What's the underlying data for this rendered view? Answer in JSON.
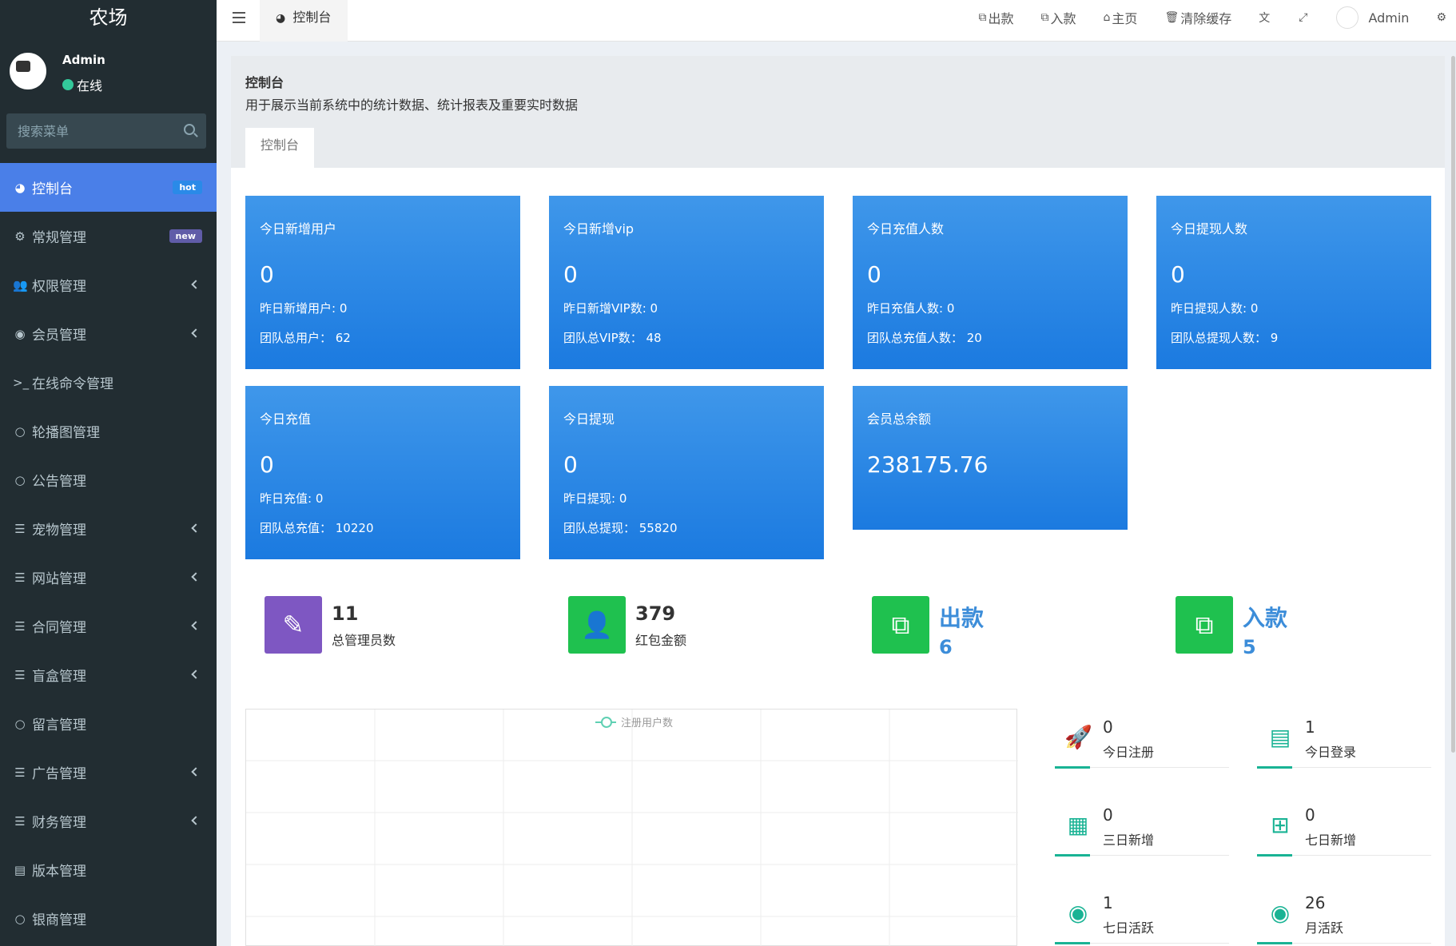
{
  "app": {
    "brand": "农场"
  },
  "user": {
    "name": "Admin",
    "status": "在线"
  },
  "search": {
    "placeholder": "搜索菜单"
  },
  "menu": [
    {
      "label": "控制台",
      "icon": "dashboard-icon",
      "badge": "hot"
    },
    {
      "label": "常规管理",
      "icon": "cogs-icon",
      "badge": "new"
    },
    {
      "label": "权限管理",
      "icon": "users-icon",
      "chevron": true
    },
    {
      "label": "会员管理",
      "icon": "user-circle-icon",
      "chevron": true
    },
    {
      "label": "在线命令管理",
      "icon": "terminal-icon"
    },
    {
      "label": "轮播图管理",
      "icon": "circle-icon"
    },
    {
      "label": "公告管理",
      "icon": "circle-icon"
    },
    {
      "label": "宠物管理",
      "icon": "list-icon",
      "chevron": true
    },
    {
      "label": "网站管理",
      "icon": "list-icon",
      "chevron": true
    },
    {
      "label": "合同管理",
      "icon": "list-icon",
      "chevron": true
    },
    {
      "label": "盲盒管理",
      "icon": "list-icon",
      "chevron": true
    },
    {
      "label": "留言管理",
      "icon": "circle-icon"
    },
    {
      "label": "广告管理",
      "icon": "list-icon",
      "chevron": true
    },
    {
      "label": "财务管理",
      "icon": "list-icon",
      "chevron": true
    },
    {
      "label": "版本管理",
      "icon": "file-icon"
    },
    {
      "label": "银商管理",
      "icon": "circle-icon"
    }
  ],
  "topbar": {
    "tab": "控制台",
    "nav": [
      "出款",
      "入款",
      "主页",
      "清除缓存"
    ],
    "user": "Admin"
  },
  "header": {
    "title": "控制台",
    "desc": "用于展示当前系统中的统计数据、统计报表及重要实时数据",
    "tab": "控制台"
  },
  "cards": [
    {
      "title": "今日新增用户",
      "value": "0",
      "line1": "昨日新增用户: 0",
      "line2": "团队总用户： 62"
    },
    {
      "title": "今日新增vip",
      "value": "0",
      "line1": "昨日新增VIP数: 0",
      "line2": "团队总VIP数： 48"
    },
    {
      "title": "今日充值人数",
      "value": "0",
      "line1": "昨日充值人数: 0",
      "line2": "团队总充值人数： 20"
    },
    {
      "title": "今日提现人数",
      "value": "0",
      "line1": "昨日提现人数: 0",
      "line2": "团队总提现人数： 9"
    },
    {
      "title": "今日充值",
      "value": "0",
      "line1": "昨日充值: 0",
      "line2": "团队总充值： 10220"
    },
    {
      "title": "今日提现",
      "value": "0",
      "line1": "昨日提现: 0",
      "line2": "团队总提现： 55820"
    },
    {
      "title": "会员总余额",
      "value": "238175.76"
    }
  ],
  "mini": [
    {
      "num": "11",
      "label": "总管理员数",
      "color": "#7e57c2"
    },
    {
      "num": "379",
      "label": "红包金额",
      "color": "#1fc14f"
    },
    {
      "big": "出款",
      "bignum": "6",
      "color": "#1fc14f"
    },
    {
      "big": "入款",
      "bignum": "5",
      "color": "#1fc14f"
    }
  ],
  "chart": {
    "legend": "注册用户数"
  },
  "stats": [
    {
      "num": "0",
      "label": "今日注册",
      "icon": "rocket-icon"
    },
    {
      "num": "1",
      "label": "今日登录",
      "icon": "id-card-icon"
    },
    {
      "num": "0",
      "label": "三日新增",
      "icon": "calendar-icon"
    },
    {
      "num": "0",
      "label": "七日新增",
      "icon": "calendar-plus-icon"
    },
    {
      "num": "1",
      "label": "七日活跃",
      "icon": "user-circle-icon"
    },
    {
      "num": "26",
      "label": "月活跃",
      "icon": "user-circle-icon"
    }
  ]
}
